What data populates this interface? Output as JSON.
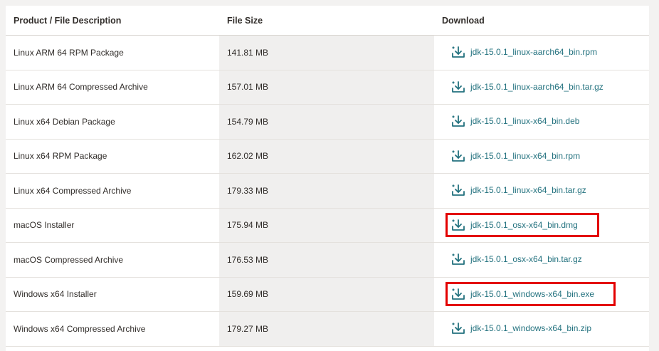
{
  "table": {
    "headers": {
      "description": "Product / File Description",
      "size": "File Size",
      "download": "Download"
    },
    "rows": [
      {
        "description": "Linux ARM 64 RPM Package",
        "size": "141.81 MB",
        "file": "jdk-15.0.1_linux-aarch64_bin.rpm",
        "highlighted": false
      },
      {
        "description": "Linux ARM 64 Compressed Archive",
        "size": "157.01 MB",
        "file": "jdk-15.0.1_linux-aarch64_bin.tar.gz",
        "highlighted": false
      },
      {
        "description": "Linux x64 Debian Package",
        "size": "154.79 MB",
        "file": "jdk-15.0.1_linux-x64_bin.deb",
        "highlighted": false
      },
      {
        "description": "Linux x64 RPM Package",
        "size": "162.02 MB",
        "file": "jdk-15.0.1_linux-x64_bin.rpm",
        "highlighted": false
      },
      {
        "description": "Linux x64 Compressed Archive",
        "size": "179.33 MB",
        "file": "jdk-15.0.1_linux-x64_bin.tar.gz",
        "highlighted": false
      },
      {
        "description": "macOS Installer",
        "size": "175.94 MB",
        "file": "jdk-15.0.1_osx-x64_bin.dmg",
        "highlighted": true
      },
      {
        "description": "macOS Compressed Archive",
        "size": "176.53 MB",
        "file": "jdk-15.0.1_osx-x64_bin.tar.gz",
        "highlighted": false
      },
      {
        "description": "Windows x64 Installer",
        "size": "159.69 MB",
        "file": "jdk-15.0.1_windows-x64_bin.exe",
        "highlighted": true
      },
      {
        "description": "Windows x64 Compressed Archive",
        "size": "179.27 MB",
        "file": "jdk-15.0.1_windows-x64_bin.zip",
        "highlighted": false
      }
    ],
    "download_icon": "download-icon"
  },
  "colors": {
    "link": "#22717e",
    "highlight_border": "#e30000",
    "size_column_bg": "#f0efee"
  }
}
